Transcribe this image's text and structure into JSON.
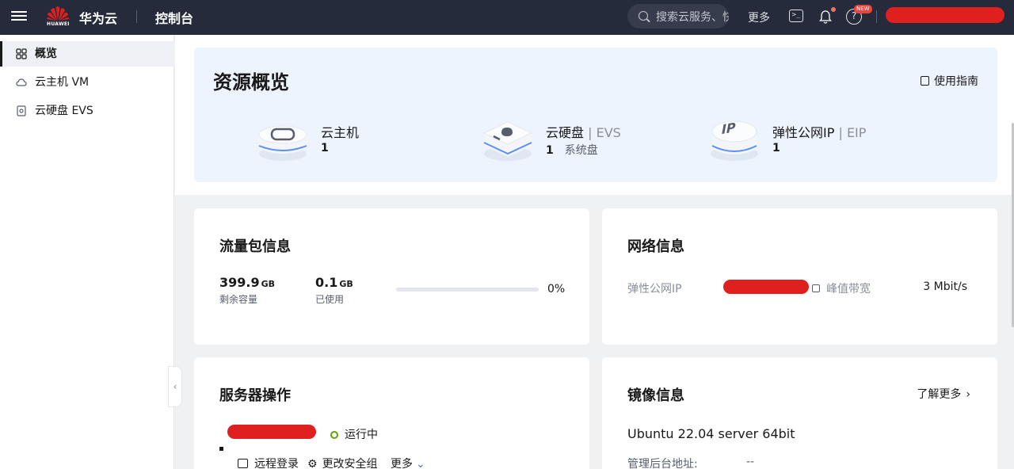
{
  "topbar": {
    "logo_text": "HUAWEI",
    "brand": "华为云",
    "console": "控制台",
    "search_placeholder": "搜索云服务、快",
    "more": "更多",
    "terminal_glyph": ">_",
    "help_glyph": "?",
    "new_badge": "NEW"
  },
  "sidebar": {
    "items": [
      {
        "label": "概览",
        "icon": "grid-icon"
      },
      {
        "label": "云主机 VM",
        "icon": "cloud-icon"
      },
      {
        "label": "云硬盘 EVS",
        "icon": "disk-icon"
      }
    ],
    "collapse_glyph": "‹"
  },
  "overview": {
    "title": "资源概览",
    "guide": "使用指南",
    "resources": [
      {
        "label": "云主机",
        "sub": "",
        "count": "1",
        "extra": ""
      },
      {
        "label": "云硬盘",
        "sub": " | EVS",
        "count": "1",
        "extra": "系统盘"
      },
      {
        "label": "弹性公网IP",
        "sub": " | EIP",
        "count": "1",
        "extra": ""
      }
    ]
  },
  "traffic": {
    "title": "流量包信息",
    "remaining_value": "399.9",
    "remaining_unit": "GB",
    "remaining_label": "剩余容量",
    "used_value": "0.1",
    "used_unit": "GB",
    "used_label": "已使用",
    "used_percent": 0,
    "percent_text": "0%"
  },
  "network": {
    "title": "网络信息",
    "eip_label": "弹性公网IP",
    "bandwidth_label": "峰值带宽",
    "bandwidth_value": "3 Mbit/s"
  },
  "server": {
    "title": "服务器操作",
    "status": "运行中",
    "ops": [
      "远程登录",
      "更改安全组",
      "更多"
    ]
  },
  "image": {
    "title": "镜像信息",
    "learn_more": "了解更多",
    "os": "Ubuntu 22.04 server 64bit",
    "admin_label": "管理后台地址:",
    "admin_value": "--"
  },
  "colors": {
    "topbar": "#252b3a",
    "accent_blue": "#526ecc",
    "status_green": "#5ea100",
    "redaction": "#e0201f"
  }
}
